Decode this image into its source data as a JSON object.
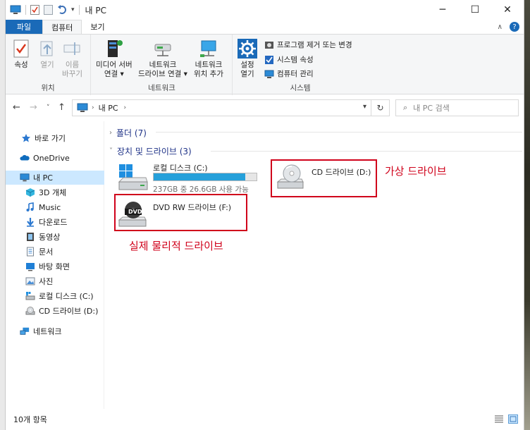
{
  "window": {
    "title": "내 PC",
    "controls": {
      "minimize": "─",
      "maximize": "☐",
      "close": "✕"
    }
  },
  "tabs": [
    {
      "label": "파일"
    },
    {
      "label": "컴퓨터"
    },
    {
      "label": "보기"
    }
  ],
  "ribbon": {
    "location": {
      "label": "위치",
      "properties": "속성",
      "open": "열기",
      "rename_line1": "이름",
      "rename_line2": "바꾸기"
    },
    "network": {
      "label": "네트워크",
      "media_line1": "미디어 서버",
      "media_line2": "연결 ▾",
      "map_line1": "네트워크",
      "map_line2": "드라이브 연결 ▾",
      "add_line1": "네트워크",
      "add_line2": "위치 추가"
    },
    "system": {
      "label": "시스템",
      "settings_line1": "설정",
      "settings_line2": "열기",
      "uninstall": "프로그램 제거 또는 변경",
      "sys_props": "시스템 속성",
      "manage": "컴퓨터 관리"
    }
  },
  "address": {
    "crumb": "내 PC",
    "search_placeholder": "내 PC 검색"
  },
  "nav": [
    {
      "label": "바로 가기",
      "icon": "star-icon"
    },
    {
      "label": "OneDrive",
      "icon": "cloud-icon"
    },
    {
      "label": "내 PC",
      "icon": "computer-icon"
    },
    {
      "label": "3D 개체",
      "icon": "cube-icon"
    },
    {
      "label": "Music",
      "icon": "music-icon"
    },
    {
      "label": "다운로드",
      "icon": "download-icon"
    },
    {
      "label": "동영상",
      "icon": "video-icon"
    },
    {
      "label": "문서",
      "icon": "document-icon"
    },
    {
      "label": "바탕 화면",
      "icon": "desktop-icon"
    },
    {
      "label": "사진",
      "icon": "picture-icon"
    },
    {
      "label": "로컬 디스크 (C:)",
      "icon": "hdd-icon"
    },
    {
      "label": "CD 드라이브 (D:)",
      "icon": "cd-icon"
    },
    {
      "label": "네트워크",
      "icon": "network-icon"
    }
  ],
  "content": {
    "folders_header": "폴더 (7)",
    "devices_header": "장치 및 드라이브 (3)",
    "drives": [
      {
        "name": "로컬 디스크 (C:)",
        "sub": "237GB 중 26.6GB 사용 가능",
        "used_fraction": 0.888
      },
      {
        "name": "CD 드라이브 (D:)"
      },
      {
        "name": "DVD RW 드라이브 (F:)",
        "badge": "DVD"
      }
    ],
    "annotations": {
      "virtual": "가상 드라이브",
      "physical": "실제 물리적 드라이브"
    }
  },
  "status": {
    "count": "10개 항목"
  },
  "colors": {
    "accent": "#1a6ab8",
    "selection": "#cce8ff",
    "annotation": "#d0021b",
    "usage_bar": "#26a0da"
  }
}
